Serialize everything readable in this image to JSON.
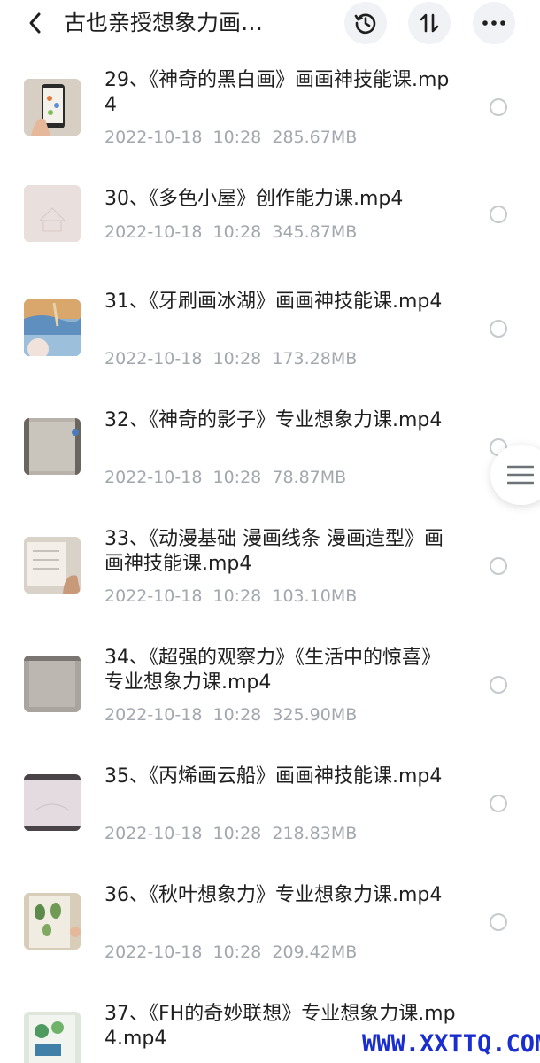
{
  "header": {
    "title": "古也亲授想象力画…",
    "back_icon": "chevron-left-icon",
    "history_icon": "clock-history-icon",
    "sort_icon": "sort-arrows-icon",
    "more_icon": "more-dots-icon"
  },
  "files": [
    {
      "name": "29、《神奇的黑白画》画画神技能课.mp4",
      "date": "2022-10-18  10:28",
      "size": "285.67MB"
    },
    {
      "name": "30、《多色小屋》创作能力课.mp4",
      "date": "2022-10-18  10:28",
      "size": "345.87MB"
    },
    {
      "name": "31、《牙刷画冰湖》画画神技能课.mp4",
      "date": "2022-10-18  10:28",
      "size": "173.28MB"
    },
    {
      "name": "32、《神奇的影子》专业想象力课.mp4",
      "date": "2022-10-18  10:28",
      "size": "78.87MB"
    },
    {
      "name": "33、《动漫基础 漫画线条 漫画造型》画画神技能课.mp4",
      "date": "2022-10-18  10:28",
      "size": "103.10MB"
    },
    {
      "name": "34、《超强的观察力》《生活中的惊喜》专业想象力课.mp4",
      "date": "2022-10-18  10:28",
      "size": "325.90MB"
    },
    {
      "name": "35、《丙烯画云船》画画神技能课.mp4",
      "date": "2022-10-18  10:28",
      "size": "218.83MB"
    },
    {
      "name": "36、《秋叶想象力》专业想象力课.mp4",
      "date": "2022-10-18  10:28",
      "size": "209.42MB"
    },
    {
      "name": "37、《FH的奇妙联想》专业想象力课.mp4.mp4",
      "date": "",
      "size": ""
    }
  ],
  "floating_tab": {
    "icon": "menu-lines-icon"
  },
  "watermark": "WWW.XXTTQ.COM",
  "colors": {
    "text_primary": "#1f1f1f",
    "text_secondary": "#a3a7ae",
    "button_bg": "#f1f2f5",
    "radio_border": "#c6c9ce",
    "watermark": "#1a2ecf"
  }
}
